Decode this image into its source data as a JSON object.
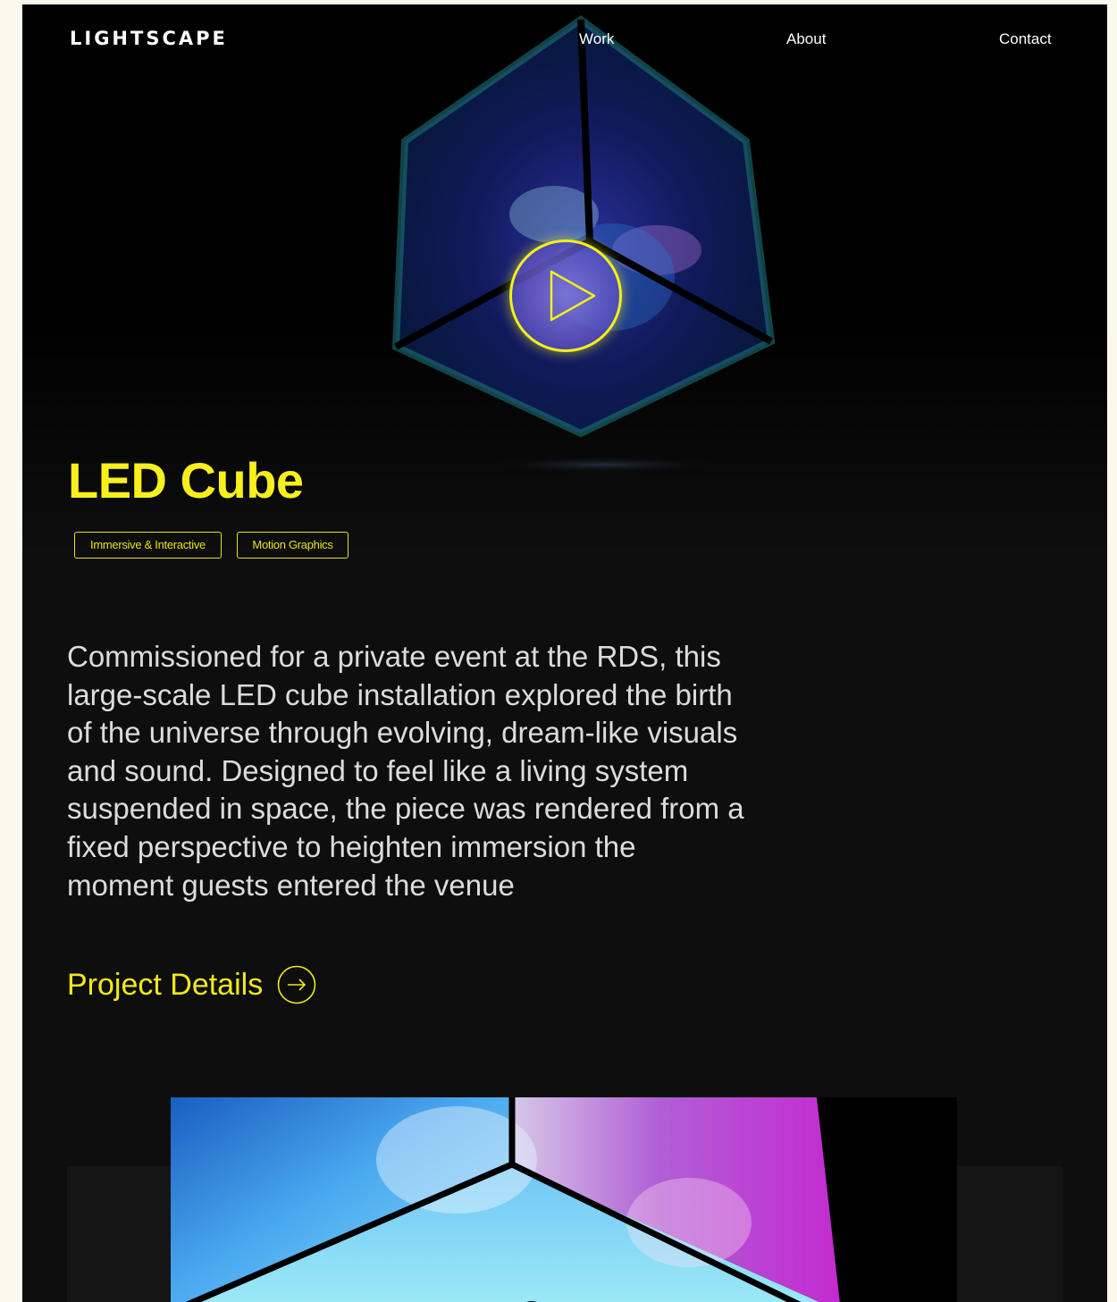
{
  "header": {
    "logo": "LIGHTSCAPE",
    "nav": [
      {
        "label": "Work"
      },
      {
        "label": "About"
      },
      {
        "label": "Contact"
      }
    ]
  },
  "hero": {
    "media": "led-cube-video",
    "play_icon": "play-icon"
  },
  "project": {
    "title": "LED Cube",
    "tags": [
      "Immersive & Interactive",
      "Motion Graphics"
    ],
    "description": "Commissioned for a private event at the RDS, this large-scale LED cube installation explored the birth of the universe through evolving, dream-like visuals and sound. Designed to feel like a living system suspended in space, the piece was rendered from a fixed perspective to heighten immersion the moment guests entered the venue",
    "details_link": "Project Details",
    "details_icon": "arrow-right-circle-icon"
  },
  "colors": {
    "accent": "#f3f01a",
    "background": "#0e0e0e",
    "text": "#dcdcdc"
  }
}
